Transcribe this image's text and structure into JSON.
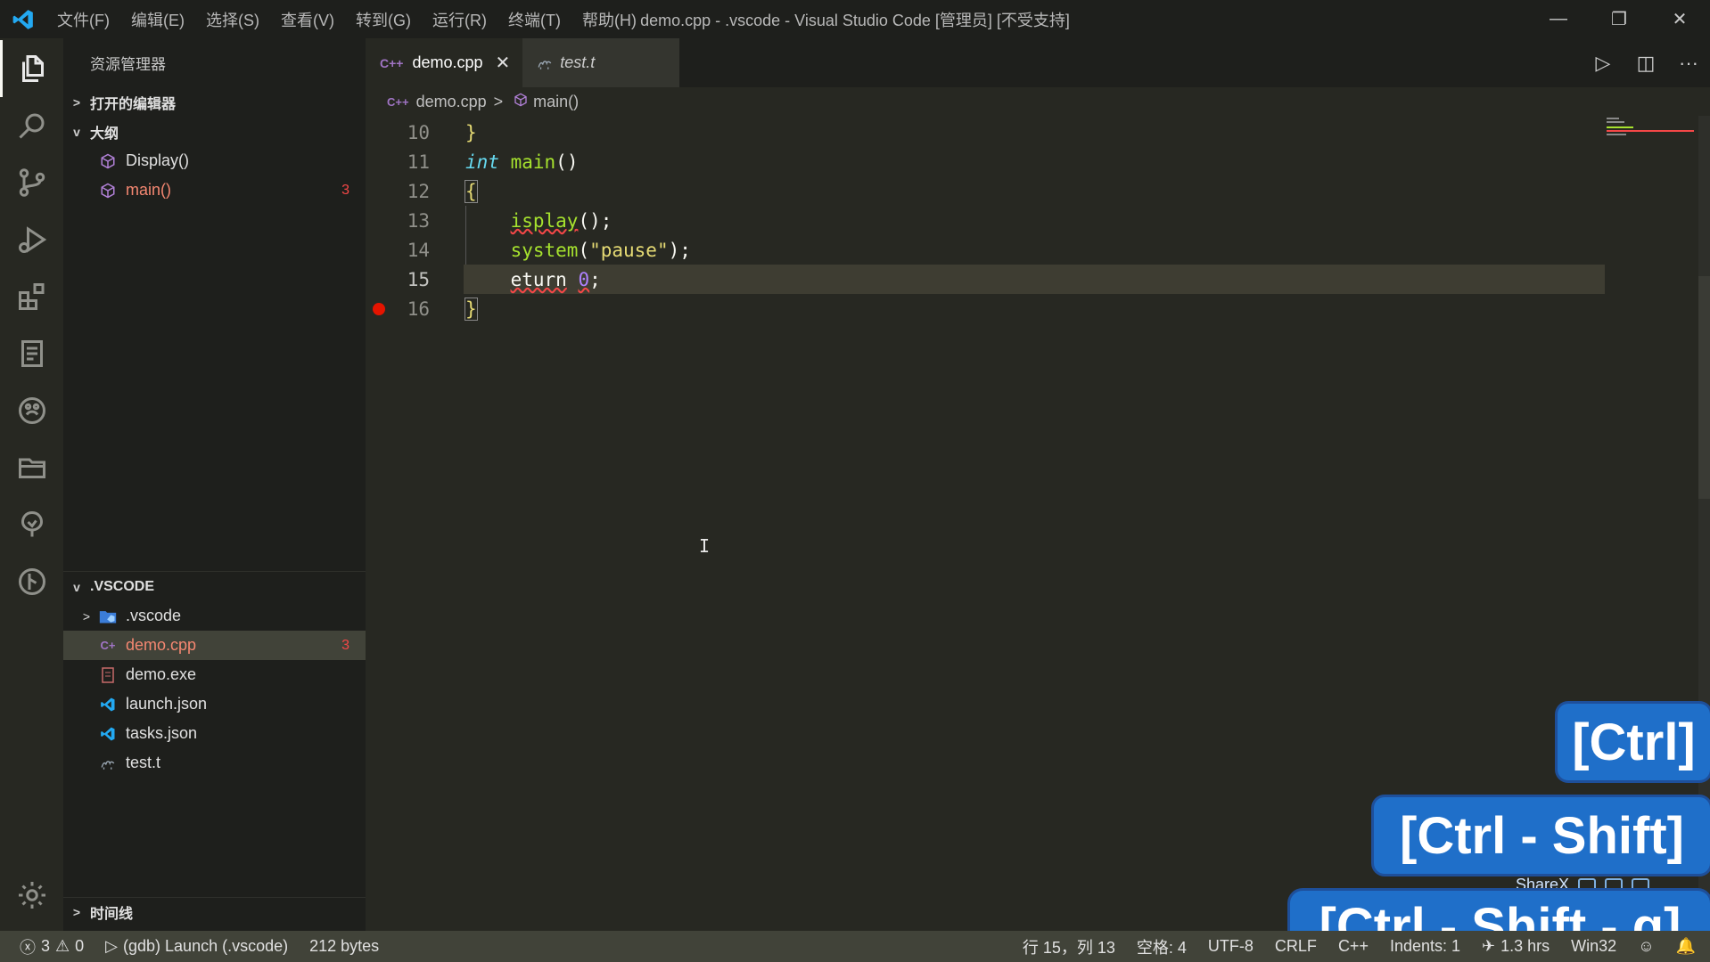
{
  "titlebar": {
    "menus": [
      "文件(F)",
      "编辑(E)",
      "选择(S)",
      "查看(V)",
      "转到(G)",
      "运行(R)",
      "终端(T)",
      "帮助(H)"
    ],
    "title": "demo.cpp - .vscode - Visual Studio Code [管理员] [不受支持]",
    "controls": {
      "minimize": "—",
      "restore": "❐",
      "close": "✕"
    }
  },
  "activity_bar": [
    "explorer-icon",
    "search-icon",
    "source-control-icon",
    "run-debug-icon",
    "extensions-icon",
    "remote-explorer-icon",
    "paw-icon",
    "folder-icon",
    "tree-icon",
    "git-graph-icon",
    "settings-gear-icon"
  ],
  "sidebar": {
    "title": "资源管理器",
    "open_editors": "打开的编辑器",
    "outline": {
      "label": "大纲",
      "items": [
        {
          "label": "Display()",
          "count": ""
        },
        {
          "label": "main()",
          "count": "3"
        }
      ]
    },
    "workspace": {
      "label": ".VSCODE",
      "items": [
        {
          "label": ".vscode",
          "count": ""
        },
        {
          "label": "demo.cpp",
          "count": "3"
        },
        {
          "label": "demo.exe",
          "count": ""
        },
        {
          "label": "launch.json",
          "count": ""
        },
        {
          "label": "tasks.json",
          "count": ""
        },
        {
          "label": "test.t",
          "count": ""
        }
      ]
    },
    "timeline": "时间线"
  },
  "tabs": [
    {
      "label": "demo.cpp",
      "icon": "C++",
      "close": "✕"
    },
    {
      "label": "test.t"
    }
  ],
  "editor_actions": {
    "run": "▷",
    "split": "◫",
    "more": "···"
  },
  "breadcrumb": {
    "icon": "C++",
    "file": "demo.cpp",
    "separator": ">",
    "symbol": "main()"
  },
  "code": {
    "lines": [
      {
        "num": "10",
        "text": "}"
      },
      {
        "num": "11",
        "kw": "int",
        "fn": "main",
        "rest": "()"
      },
      {
        "num": "12",
        "text": "{"
      },
      {
        "num": "13",
        "fn": "isplay",
        "rest": "();"
      },
      {
        "num": "14",
        "fn": "system",
        "open": "(",
        "str": "\"pause\"",
        "rest": ");"
      },
      {
        "num": "15",
        "word": "eturn",
        "space": " ",
        "numv": "0",
        "rest": ";"
      },
      {
        "num": "16",
        "text": "}"
      }
    ]
  },
  "overlays": {
    "keycast": [
      "[Ctrl]",
      "[Ctrl - Shift]",
      "[Ctrl - Shift - g]"
    ],
    "sharex": "ShareX"
  },
  "status": {
    "errors": "3",
    "warnings": "0",
    "launch": "(gdb) Launch (.vscode)",
    "size": "212 bytes",
    "position": "行 15，列 13",
    "spaces": "空格: 4",
    "encoding": "UTF-8",
    "eol": "CRLF",
    "language": "C++",
    "indents": "Indents: 1",
    "time": "1.3 hrs",
    "platform": "Win32"
  }
}
